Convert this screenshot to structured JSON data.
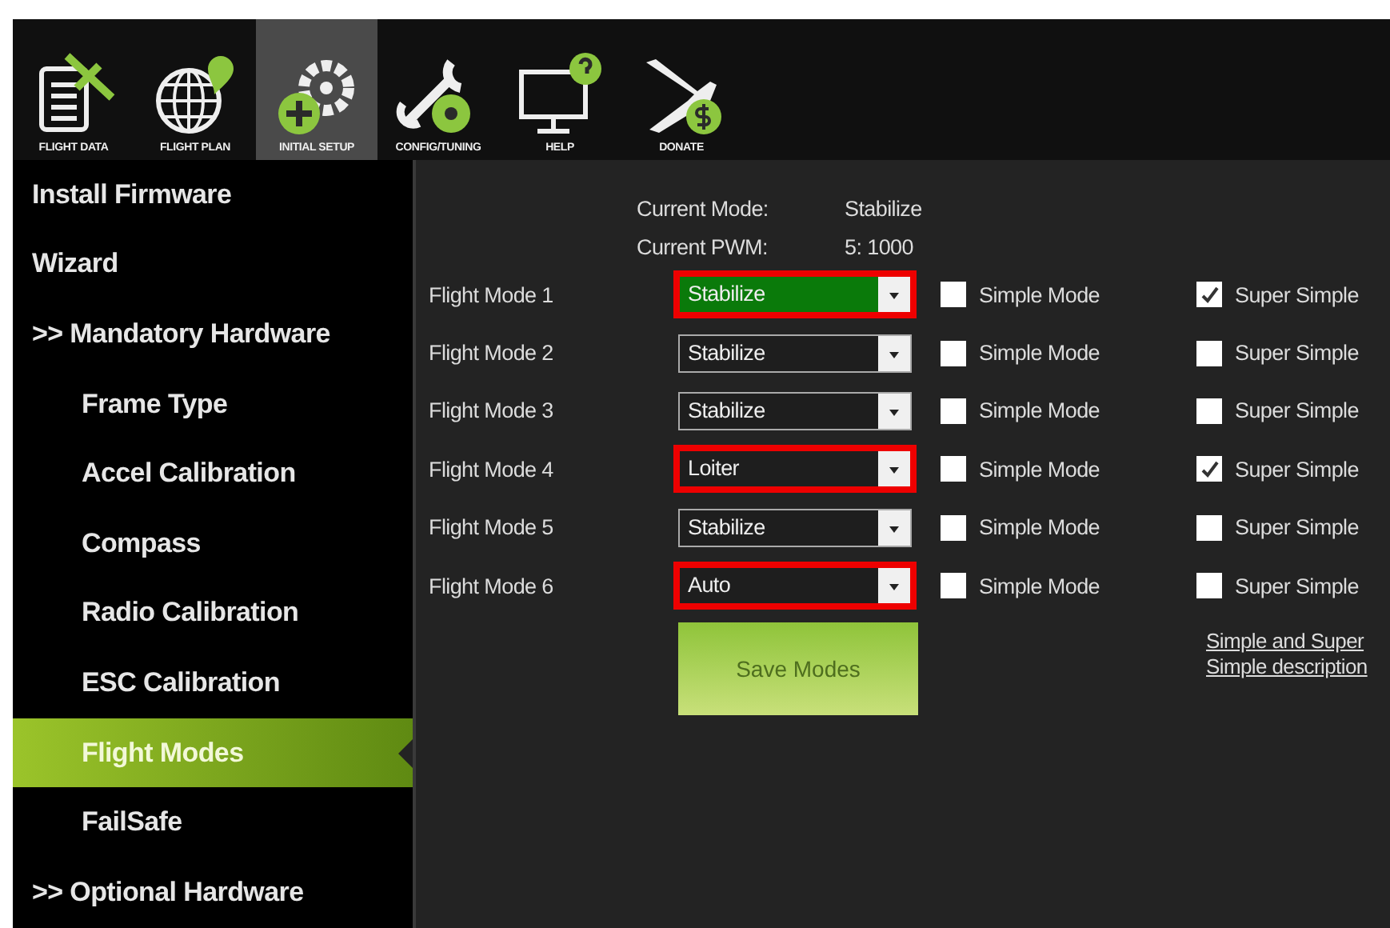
{
  "toolbar": [
    {
      "label": "FLIGHT DATA",
      "selected": false
    },
    {
      "label": "FLIGHT PLAN",
      "selected": false
    },
    {
      "label": "INITIAL SETUP",
      "selected": true
    },
    {
      "label": "CONFIG/TUNING",
      "selected": false
    },
    {
      "label": "HELP",
      "selected": false
    },
    {
      "label": "DONATE",
      "selected": false
    }
  ],
  "sidebar": {
    "items": [
      {
        "label": "Install Firmware",
        "selected": false
      },
      {
        "label": "Wizard",
        "selected": false
      },
      {
        "label": ">> Mandatory Hardware",
        "selected": false,
        "children": [
          {
            "label": "Frame Type",
            "selected": false
          },
          {
            "label": "Accel Calibration",
            "selected": false
          },
          {
            "label": "Compass",
            "selected": false
          },
          {
            "label": "Radio Calibration",
            "selected": false
          },
          {
            "label": "ESC Calibration",
            "selected": false
          },
          {
            "label": "Flight Modes",
            "selected": true
          },
          {
            "label": "FailSafe",
            "selected": false
          }
        ]
      },
      {
        "label": ">> Optional Hardware",
        "selected": false
      }
    ]
  },
  "status": [
    {
      "label": "Current Mode:",
      "value": "Stabilize"
    },
    {
      "label": "Current PWM:",
      "value": "5: 1000"
    }
  ],
  "flight_modes": [
    {
      "label": "Flight Mode 1",
      "value": "Stabilize",
      "active": true,
      "highlighted": true,
      "simple_label": "Simple Mode",
      "simple": false,
      "super_label": "Super Simple",
      "super_simple": true
    },
    {
      "label": "Flight Mode 2",
      "value": "Stabilize",
      "active": false,
      "highlighted": false,
      "simple_label": "Simple Mode",
      "simple": false,
      "super_label": "Super Simple",
      "super_simple": false
    },
    {
      "label": "Flight Mode 3",
      "value": "Stabilize",
      "active": false,
      "highlighted": false,
      "simple_label": "Simple Mode",
      "simple": false,
      "super_label": "Super Simple",
      "super_simple": false
    },
    {
      "label": "Flight Mode 4",
      "value": "Loiter",
      "active": false,
      "highlighted": true,
      "simple_label": "Simple Mode",
      "simple": false,
      "super_label": "Super Simple",
      "super_simple": true
    },
    {
      "label": "Flight Mode 5",
      "value": "Stabilize",
      "active": false,
      "highlighted": false,
      "simple_label": "Simple Mode",
      "simple": false,
      "super_label": "Super Simple",
      "super_simple": false
    },
    {
      "label": "Flight Mode 6",
      "value": "Auto",
      "active": false,
      "highlighted": true,
      "simple_label": "Simple Mode",
      "simple": false,
      "super_label": "Super Simple",
      "super_simple": false
    }
  ],
  "save_button": "Save Modes",
  "description_link": [
    "Simple and Super",
    "Simple description"
  ]
}
